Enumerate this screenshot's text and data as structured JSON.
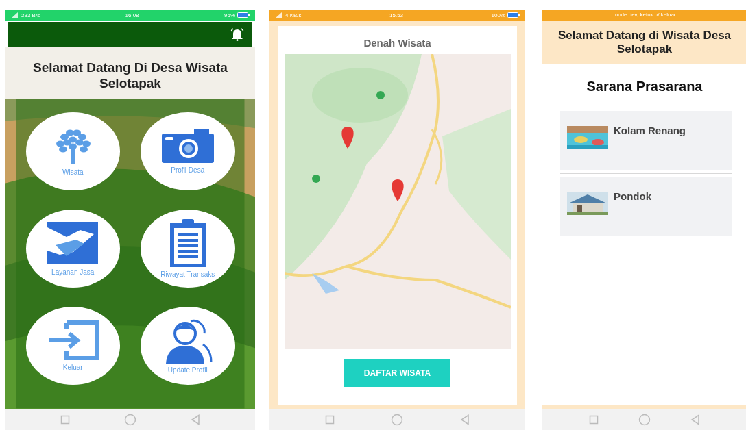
{
  "menu_screen": {
    "status_bar": {
      "network_speed": "233 B/s",
      "time": "16.08",
      "battery": "95%"
    },
    "title": "Selamat Datang Di Desa Wisata Selotapak",
    "menu_items": [
      {
        "label": "Wisata"
      },
      {
        "label": "Profil Desa"
      },
      {
        "label": "Layanan Jasa"
      },
      {
        "label": "Riwayat Transaks"
      },
      {
        "label": "Keluar"
      },
      {
        "label": "Update Profil"
      }
    ]
  },
  "map_screen": {
    "status_bar": {
      "network_speed": "4 KB/s",
      "time": "15.53",
      "battery": "100%"
    },
    "title": "Denah Wisata",
    "button": "DAFTAR WISATA"
  },
  "facilities_screen": {
    "banner": "mode dev, ketuk u/ keluar",
    "header": "Selamat Datang di Wisata Desa Selotapak",
    "title": "Sarana Prasarana",
    "items": [
      {
        "name": "Kolam Renang"
      },
      {
        "name": "Pondok"
      }
    ]
  }
}
